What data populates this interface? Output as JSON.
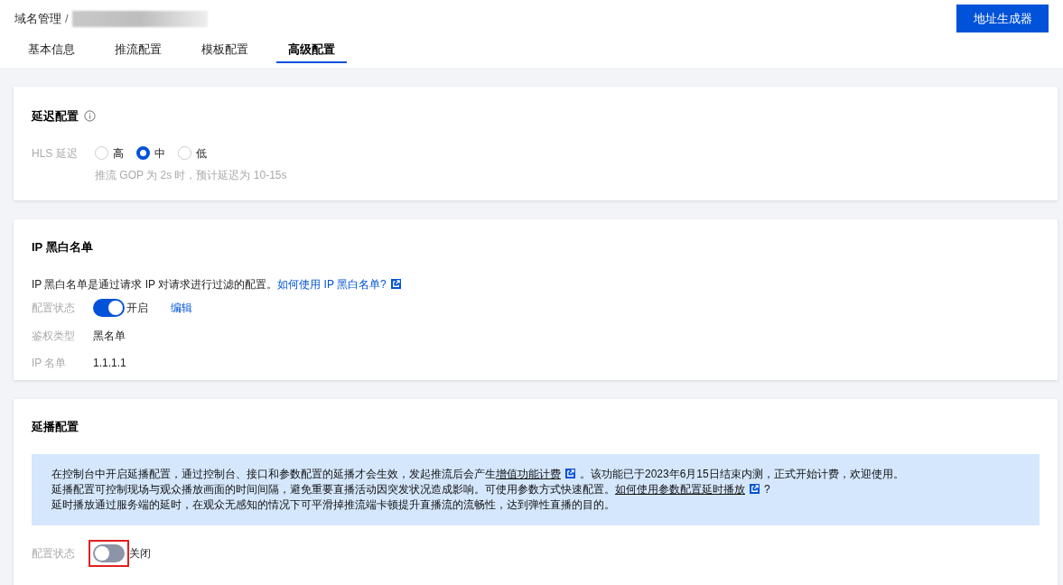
{
  "breadcrumb": {
    "root": "域名管理",
    "separator": "/"
  },
  "generator_button": "地址生成器",
  "tabs": [
    {
      "label": "基本信息",
      "selected": false
    },
    {
      "label": "推流配置",
      "selected": false
    },
    {
      "label": "模板配置",
      "selected": false
    },
    {
      "label": "高级配置",
      "selected": true
    }
  ],
  "latency": {
    "title": "延迟配置",
    "label": "HLS 延迟",
    "options": [
      {
        "label": "高",
        "selected": false
      },
      {
        "label": "中",
        "selected": true
      },
      {
        "label": "低",
        "selected": false
      }
    ],
    "hint": "推流 GOP 为 2s 时，预计延迟为 10-15s"
  },
  "ip_list": {
    "title": "IP 黑白名单",
    "description": "IP 黑白名单是通过请求 IP 对请求进行过滤的配置。",
    "help_link": "如何使用 IP 黑白名单?",
    "status": {
      "label": "配置状态",
      "on": true,
      "text": "开启",
      "edit": "编辑"
    },
    "fields": [
      {
        "label": "鉴权类型",
        "value": "黑名单"
      },
      {
        "label": "IP 名单",
        "value": "1.1.1.1"
      }
    ]
  },
  "delay_play": {
    "title": "延播配置",
    "notice": [
      [
        {
          "kind": "text",
          "text": "在控制台中开启延播配置，通过控制台、接口和参数配置的延播才会生效，发起推流后会产生"
        },
        {
          "kind": "link",
          "text": "增值功能计费"
        },
        {
          "kind": "text",
          "text": "。该功能已于2023年6月15日结束内测，正式开始计费，欢迎使用。"
        }
      ],
      [
        {
          "kind": "text",
          "text": "延播配置可控制现场与观众播放画面的时间间隔，避免重要直播活动因突发状况造成影响。可使用参数方式快速配置。"
        },
        {
          "kind": "link",
          "text": "如何使用参数配置延时播放"
        },
        {
          "kind": "text",
          "text": "?"
        }
      ],
      [
        {
          "kind": "text",
          "text": "延时播放通过服务端的延时，在观众无感知的情况下可平滑掉推流端卡顿提升直播流的流畅性，达到弹性直播的目的。"
        }
      ]
    ],
    "status": {
      "label": "配置状态",
      "on": false,
      "text": "关闭",
      "highlighted": true
    }
  }
}
